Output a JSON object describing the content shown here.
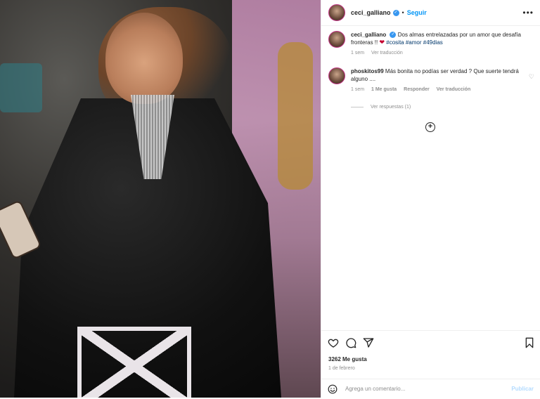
{
  "post": {
    "author": "ceci_galliano",
    "follow_label": "Seguir",
    "more_label": "•••"
  },
  "caption": {
    "author": "ceci_galliano",
    "text": "Dos almas entrelazadas por un amor que desafía fronteras !!",
    "hashtags": [
      "#cosita",
      "#amor",
      "#49dias"
    ],
    "time": "1 sem",
    "translate": "Ver traducción"
  },
  "comment": {
    "author": "phoskitos99",
    "text": "Más bonita no podías ser verdad ? Que suerte tendrá alguno ....",
    "time": "1 sem",
    "likes": "1 Me gusta",
    "reply": "Responder",
    "translate": "Ver traducción",
    "view_replies": "Ver respuestas (1)"
  },
  "footer": {
    "likes": "3262 Me gusta",
    "date": "1 de febrero",
    "comment_placeholder": "Agrega un comentario...",
    "publish": "Publicar"
  },
  "colors": {
    "accent": "#0095f6",
    "link": "#00376b",
    "muted": "#8e8e8e",
    "heart": "#c4002f"
  },
  "icons": {
    "verified": "verified-badge-icon",
    "heart": "heart-icon",
    "comment": "comment-icon",
    "share": "share-icon",
    "save": "bookmark-icon",
    "emoji": "emoji-icon",
    "add": "plus-circle-icon"
  }
}
